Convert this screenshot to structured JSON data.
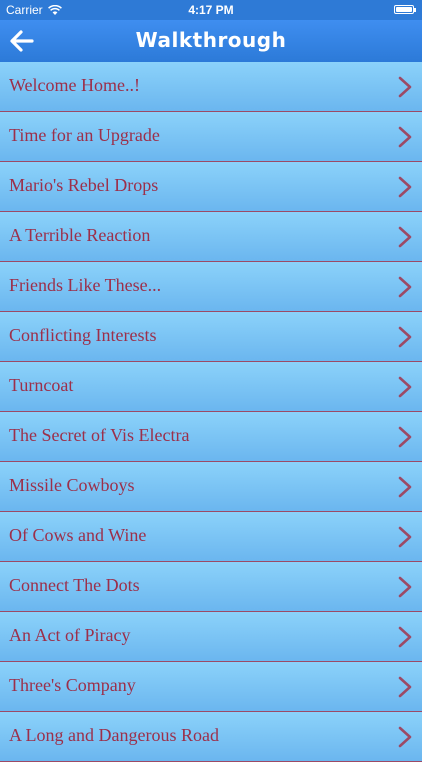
{
  "status_bar": {
    "carrier": "Carrier",
    "time": "4:17 PM",
    "icons": [
      "wifi-icon",
      "battery-icon"
    ]
  },
  "nav_bar": {
    "title": "Walkthrough",
    "back_icon": "arrow-left-icon"
  },
  "list": {
    "items": [
      {
        "label": "Welcome Home..!"
      },
      {
        "label": "Time for an Upgrade"
      },
      {
        "label": "Mario's Rebel Drops"
      },
      {
        "label": "A Terrible Reaction"
      },
      {
        "label": "Friends Like These..."
      },
      {
        "label": "Conflicting Interests"
      },
      {
        "label": "Turncoat"
      },
      {
        "label": "The Secret of Vis Electra"
      },
      {
        "label": "Missile Cowboys"
      },
      {
        "label": "Of Cows and Wine"
      },
      {
        "label": "Connect The Dots"
      },
      {
        "label": "An Act of Piracy"
      },
      {
        "label": "Three's Company"
      },
      {
        "label": "A Long and Dangerous Road"
      }
    ]
  },
  "colors": {
    "nav_blue": "#2c7ad8",
    "item_text": "#9c2f4a",
    "chevron": "#9c4a66",
    "separator": "#9c4a66"
  }
}
